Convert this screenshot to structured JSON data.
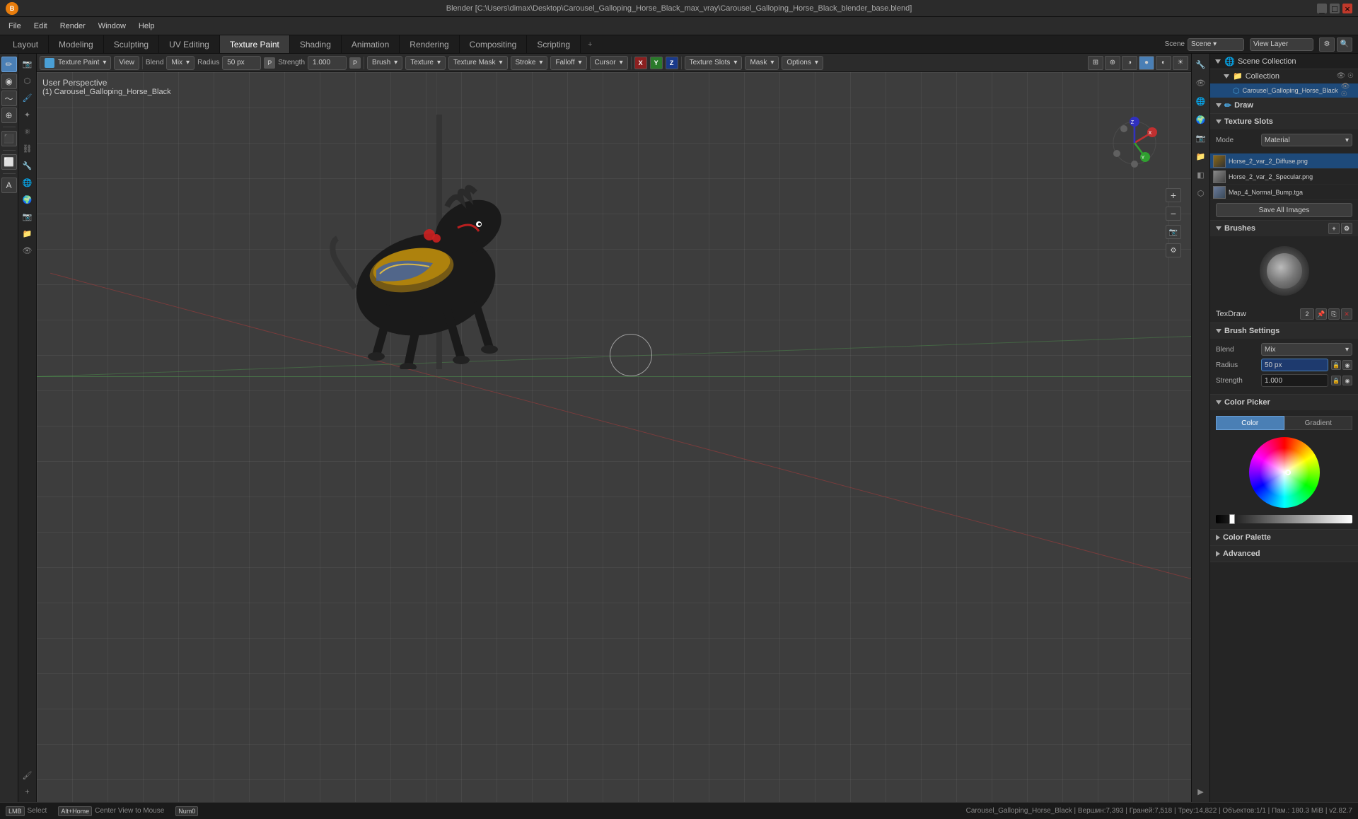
{
  "titlebar": {
    "title": "Blender [C:\\Users\\dimax\\Desktop\\Carousel_Galloping_Horse_Black_max_vray\\Carousel_Galloping_Horse_Black_blender_base.blend]"
  },
  "menubar": {
    "items": [
      "File",
      "Edit",
      "Render",
      "Window",
      "Help"
    ]
  },
  "workspace_tabs": {
    "tabs": [
      "Layout",
      "Modeling",
      "Sculpting",
      "UV Editing",
      "Texture Paint",
      "Shading",
      "Animation",
      "Rendering",
      "Compositing",
      "Scripting"
    ],
    "active": "Texture Paint",
    "extra": "+"
  },
  "viewlayer": {
    "label": "View Layer"
  },
  "header_toolbar": {
    "mode_label": "Texture Paint",
    "view_label": "View",
    "blend_label": "Mix",
    "radius_label": "Radius",
    "radius_value": "50 px",
    "strength_label": "Strength",
    "strength_value": "1.000",
    "brush_label": "Brush",
    "texture_label": "Texture",
    "texture_mask_label": "Texture Mask",
    "stroke_label": "Stroke",
    "falloff_label": "Falloff",
    "cursor_label": "Cursor",
    "xyz": [
      "X",
      "Y",
      "Z"
    ],
    "texture_slots_label": "Texture Slots",
    "mask_label": "Mask",
    "options_label": "Options"
  },
  "viewport": {
    "perspective": "User Perspective",
    "object_name": "(1) Carousel_Galloping_Horse_Black"
  },
  "right_panel": {
    "scene_collection": "Scene Collection",
    "collection": "Collection",
    "object": "Carousel_Galloping_Horse_Black",
    "sections": {
      "draw_label": "Draw",
      "texture_slots": {
        "label": "Texture Slots",
        "mode_label": "Mode",
        "mode_value": "Material",
        "items": [
          {
            "name": "Horse_2_var_2_Diffuse.png",
            "selected": true
          },
          {
            "name": "Horse_2_var_2_Specular.png",
            "selected": false
          },
          {
            "name": "Map_4_Normal_Bump.tga",
            "selected": false
          }
        ],
        "save_all_label": "Save All Images"
      },
      "brushes": {
        "label": "Brushes",
        "name": "TexDraw",
        "number": "2"
      },
      "brush_settings": {
        "label": "Brush Settings",
        "blend_label": "Blend",
        "blend_value": "Mix",
        "radius_label": "Radius",
        "radius_value": "50 px",
        "strength_label": "Strength",
        "strength_value": "1.000"
      },
      "color_picker": {
        "label": "Color Picker",
        "color_tab": "Color",
        "gradient_tab": "Gradient"
      },
      "color_palette": {
        "label": "Color Palette"
      },
      "advanced": {
        "label": "Advanced"
      }
    }
  },
  "statusbar": {
    "select_label": "Select",
    "center_view_label": "Center View to Mouse",
    "info": "Carousel_Galloping_Horse_Black | Вершин:7,393 | Граней:7,518 | Треу:14,822 | Объектов:1/1 | Пам.: 180.3 MiB | v2.82.7"
  },
  "left_tools": {
    "tools": [
      "draw",
      "soften",
      "smear",
      "clone",
      "fill",
      "mask",
      "eraser"
    ],
    "active": "draw"
  },
  "scene_icons": [
    "object",
    "mesh",
    "material",
    "texture",
    "particles",
    "physics",
    "constraints",
    "modifiers",
    "scene",
    "world",
    "render",
    "output"
  ]
}
